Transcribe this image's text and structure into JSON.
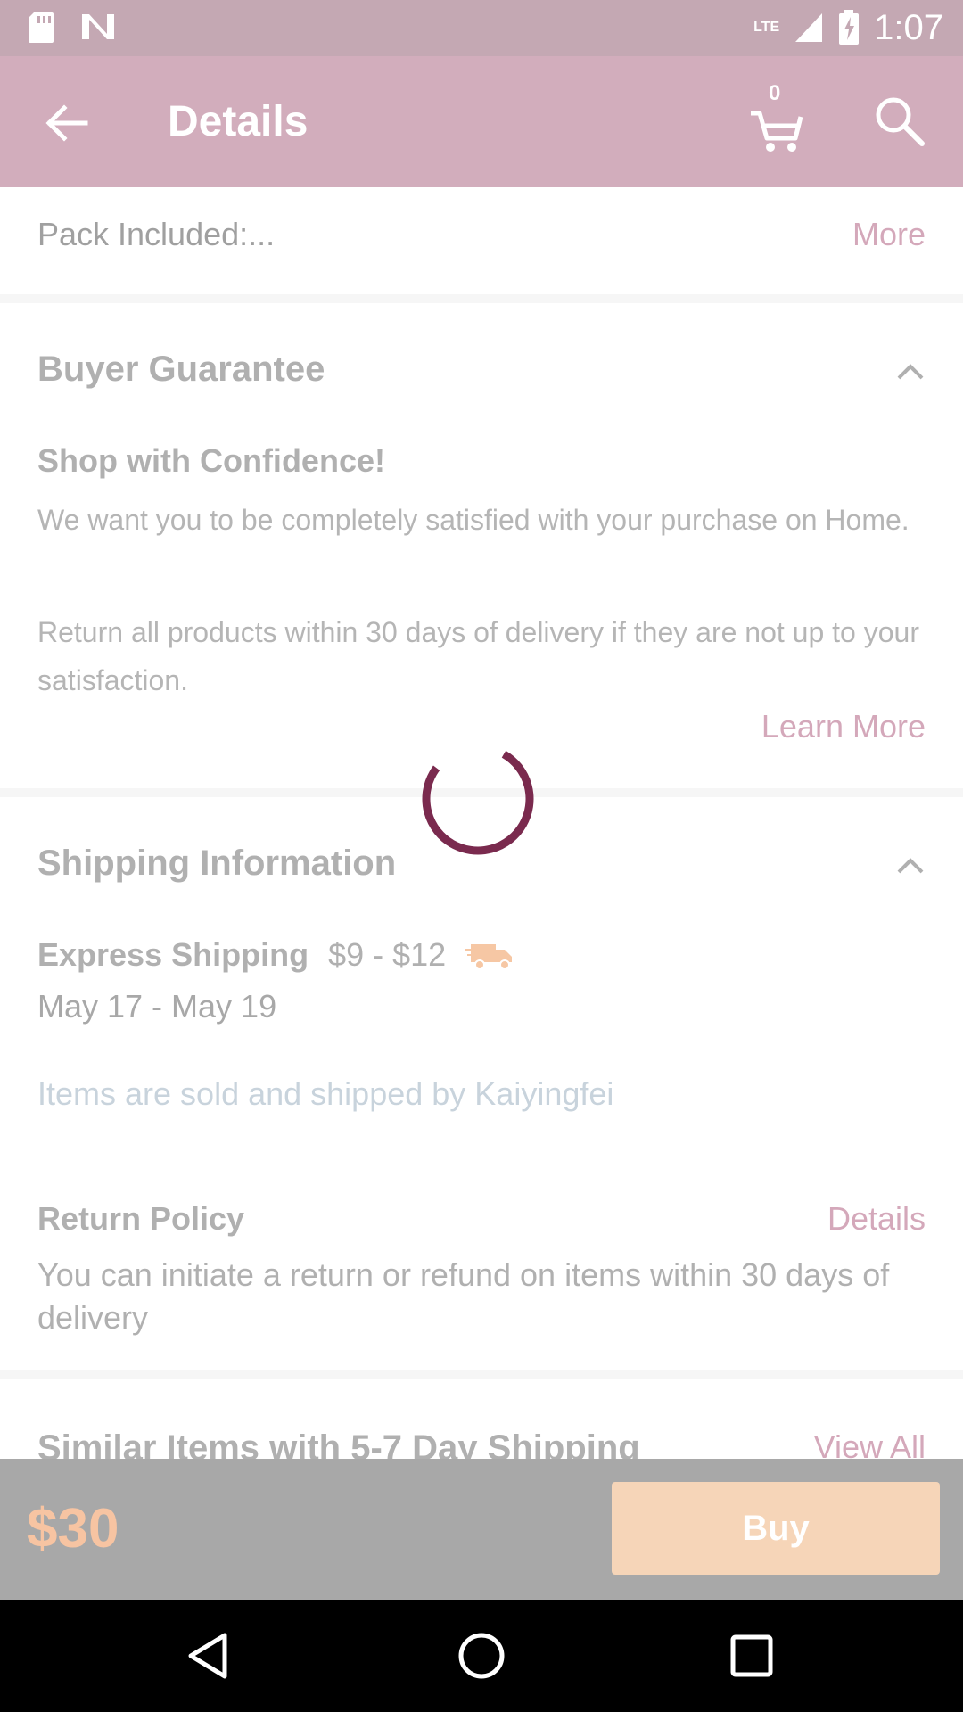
{
  "status_bar": {
    "time": "1:07",
    "network": "LTE",
    "icons": [
      "sd-card-icon",
      "n-notification-icon",
      "signal-icon",
      "battery-charging-icon"
    ]
  },
  "toolbar": {
    "title": "Details",
    "cart_count": "0",
    "icons": [
      "back-arrow-icon",
      "cart-icon",
      "search-icon"
    ]
  },
  "pack": {
    "text": "Pack Included:...",
    "more_label": "More"
  },
  "buyer_guarantee": {
    "title": "Buyer Guarantee",
    "subtitle": "Shop with Confidence!",
    "para1": "We want you to be completely satisfied with your purchase on Home.",
    "para2": "Return all products within 30 days of delivery if they are not up to your satisfaction.",
    "learn_more": "Learn More"
  },
  "shipping": {
    "title": "Shipping Information",
    "express_label": "Express Shipping",
    "express_price": "$9 - $12",
    "date_range": "May 17 - May 19",
    "sold_by": "Items are sold and shipped by Kaiyingfei"
  },
  "return_policy": {
    "title": "Return Policy",
    "details_label": "Details",
    "text": "You can initiate a return or refund on items within 30 days of delivery"
  },
  "similar": {
    "title": "Similar Items with 5-7 Day Shipping",
    "view_all": "View All"
  },
  "bottom_bar": {
    "price": "$30",
    "buy_label": "Buy"
  },
  "colors": {
    "toolbar": "#d2adbc",
    "accent_link": "#d4a8ba",
    "spinner": "#7a2a4e",
    "buy_button": "#f6d5b8",
    "price": "#f7c4a2"
  }
}
